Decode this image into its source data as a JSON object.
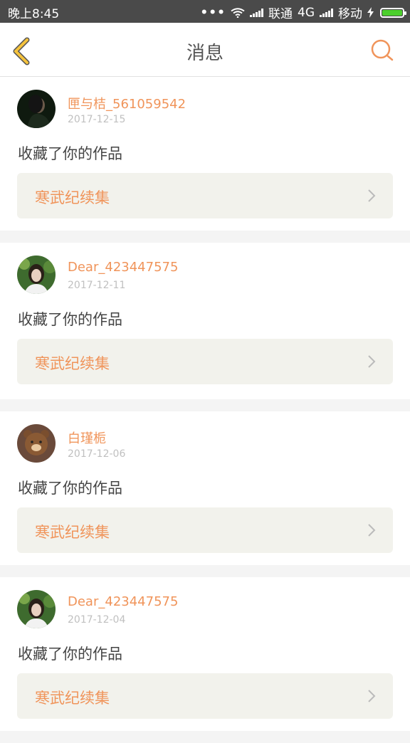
{
  "status_bar": {
    "time": "晚上8:45",
    "dots": "•••",
    "carrier1": "联通",
    "network1": "4G",
    "carrier2": "移动"
  },
  "nav": {
    "title": "消息"
  },
  "messages": [
    {
      "username": "匣与桔_561059542",
      "date": "2017-12-15",
      "action": "收藏了你的作品",
      "work": "寒武纪续集",
      "avatar": "avatar-dark"
    },
    {
      "username": "Dear_423447575",
      "date": "2017-12-11",
      "action": "收藏了你的作品",
      "work": "寒武纪续集",
      "avatar": "avatar-green"
    },
    {
      "username": "白瑾栀",
      "date": "2017-12-06",
      "action": "收藏了你的作品",
      "work": "寒武纪续集",
      "avatar": "avatar-bear"
    },
    {
      "username": "Dear_423447575",
      "date": "2017-12-04",
      "action": "收藏了你的作品",
      "work": "寒武纪续集",
      "avatar": "avatar-green"
    }
  ],
  "colors": {
    "accent": "#f0945a",
    "back_icon": "#f5c33c",
    "status_bar": "#4a4a4a"
  }
}
